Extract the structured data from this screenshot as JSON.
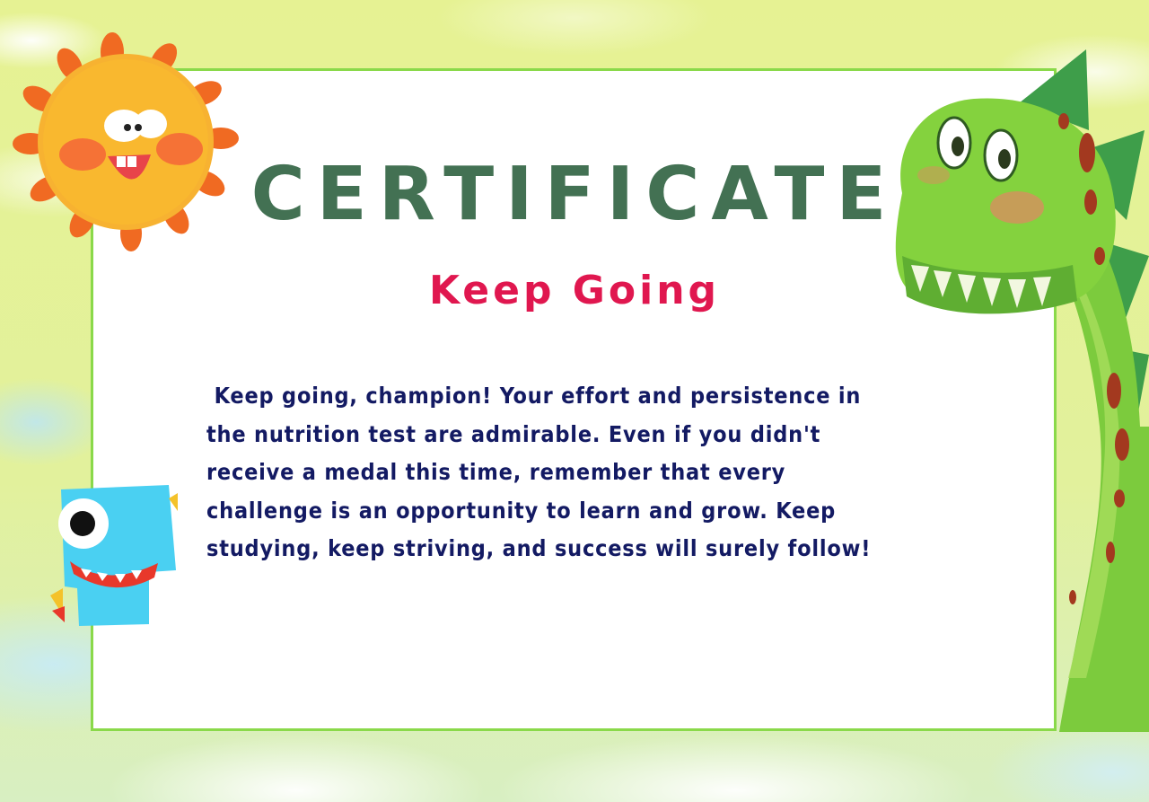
{
  "certificate": {
    "title": "CERTIFICATE",
    "subtitle": "Keep Going",
    "message": " Keep going, champion! Your effort and persistence in\nthe nutrition test are admirable. Even if you didn't\nreceive a medal this time, remember that every\nchallenge is an opportunity to learn and grow. Keep\nstudying, keep striving, and success will surely follow!"
  },
  "decorations": {
    "sun": "sun-illustration",
    "green_dinosaur": "green-dinosaur-illustration",
    "blue_dinosaur": "blue-dinosaur-illustration"
  },
  "colors": {
    "background": "#e7f29a",
    "frame_border": "#8ad94a",
    "title": "#437153",
    "subtitle": "#e0174f",
    "message": "#131a63"
  }
}
